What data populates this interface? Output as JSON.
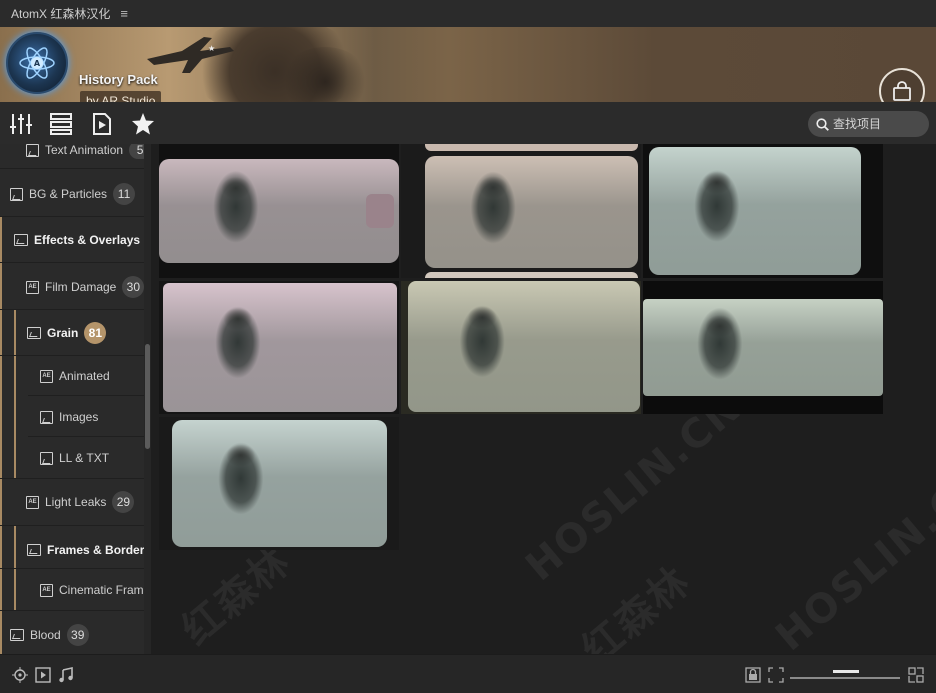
{
  "titlebar": {
    "app_name": "AtomX 红森林汉化",
    "menu_icon": "hamburger-icon"
  },
  "banner": {
    "pack_title": "History Pack",
    "author": "by AR Studio"
  },
  "toolbar": {
    "tools": [
      "mixer-icon",
      "list-icon",
      "media-icon",
      "star-icon"
    ],
    "search_placeholder": "查找项目"
  },
  "sidebar": {
    "items": [
      {
        "label": "Text Animation",
        "count": "5"
      },
      {
        "label": "BG & Particles",
        "count": "11"
      },
      {
        "label": "Effects & Overlays",
        "count": ""
      },
      {
        "label": "Film Damage",
        "count": "30"
      },
      {
        "label": "Grain",
        "count": "81"
      },
      {
        "label": "Animated"
      },
      {
        "label": "Images"
      },
      {
        "label": "LL & TXT"
      },
      {
        "label": "Light Leaks",
        "count": "29"
      },
      {
        "label": "Frames & Borders"
      },
      {
        "label": "Cinematic Frames"
      },
      {
        "label": "Blood",
        "count": "39"
      }
    ]
  },
  "grid": {
    "watermark": "HOSLIN.CN",
    "watermark_cn": "红森林",
    "thumbnails": [
      {
        "tint": "#c9b8bd"
      },
      {
        "tint": "#cdbfb4"
      },
      {
        "tint": "#c4d3cd"
      },
      {
        "tint": "#d7c3cc"
      },
      {
        "tint": "#c9c8b3"
      },
      {
        "tint": "#c6d1c4"
      },
      {
        "tint": "#c5d3cf"
      }
    ]
  },
  "footer": {
    "left_icons": [
      "target-icon",
      "play-icon",
      "music-icon"
    ],
    "right_icons": [
      "lock-icon",
      "fit-icon",
      "expand-icon"
    ]
  },
  "colors": {
    "accent": "#b4946a",
    "bg": "#232323",
    "sidebar": "#2a2a2a"
  }
}
